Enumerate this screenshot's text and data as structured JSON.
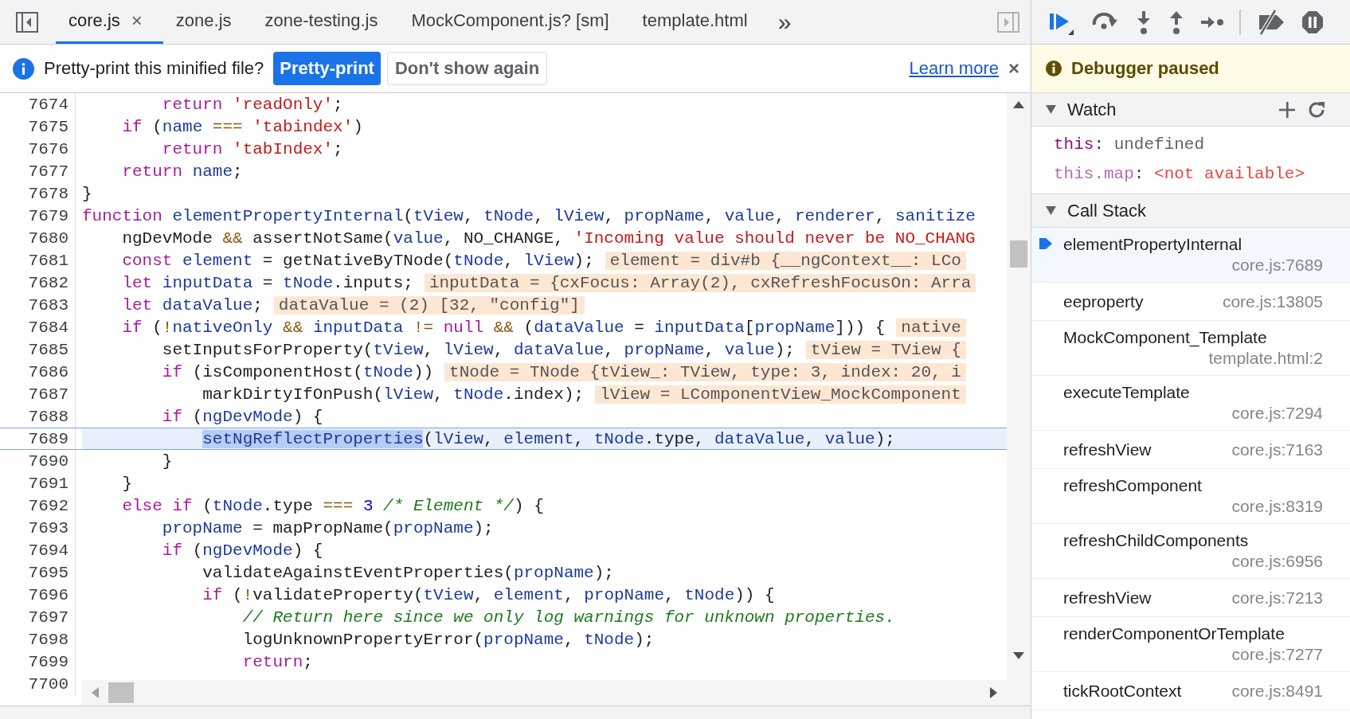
{
  "tabs": [
    {
      "label": "core.js",
      "selected": true,
      "close": "×"
    },
    {
      "label": "zone.js",
      "selected": false
    },
    {
      "label": "zone-testing.js",
      "selected": false
    },
    {
      "label": "MockComponent.js? [sm]",
      "selected": false
    },
    {
      "label": "template.html",
      "selected": false
    }
  ],
  "more_tabs": "»",
  "infobar": {
    "message": "Pretty-print this minified file?",
    "primary_button": "Pretty-print",
    "secondary_button": "Don't show again",
    "link": "Learn more",
    "close": "×"
  },
  "editor": {
    "lines": [
      {
        "number": "7674",
        "selected": false,
        "tokens": [
          {
            "kind": "kw",
            "text": "        return "
          },
          {
            "kind": "str",
            "text": "'readOnly'"
          },
          {
            "kind": "plain",
            "text": ";"
          }
        ]
      },
      {
        "number": "7675",
        "selected": false,
        "tokens": [
          {
            "kind": "kw",
            "text": "    if "
          },
          {
            "kind": "plain",
            "text": "("
          },
          {
            "kind": "var",
            "text": "name"
          },
          {
            "kind": "op",
            "text": " === "
          },
          {
            "kind": "str",
            "text": "'tabindex'"
          },
          {
            "kind": "plain",
            "text": ")"
          }
        ]
      },
      {
        "number": "7676",
        "selected": false,
        "tokens": [
          {
            "kind": "kw",
            "text": "        return "
          },
          {
            "kind": "str",
            "text": "'tabIndex'"
          },
          {
            "kind": "plain",
            "text": ";"
          }
        ]
      },
      {
        "number": "7677",
        "selected": false,
        "tokens": [
          {
            "kind": "kw",
            "text": "    return "
          },
          {
            "kind": "var",
            "text": "name"
          },
          {
            "kind": "plain",
            "text": ";"
          }
        ]
      },
      {
        "number": "7678",
        "selected": false,
        "tokens": [
          {
            "kind": "plain",
            "text": "}"
          }
        ]
      },
      {
        "number": "7679",
        "selected": false,
        "tokens": [
          {
            "kind": "kw",
            "text": "function "
          },
          {
            "kind": "var",
            "text": "elementPropertyInternal"
          },
          {
            "kind": "plain",
            "text": "("
          },
          {
            "kind": "var",
            "text": "tView"
          },
          {
            "kind": "plain",
            "text": ", "
          },
          {
            "kind": "var",
            "text": "tNode"
          },
          {
            "kind": "plain",
            "text": ", "
          },
          {
            "kind": "var",
            "text": "lView"
          },
          {
            "kind": "plain",
            "text": ", "
          },
          {
            "kind": "var",
            "text": "propName"
          },
          {
            "kind": "plain",
            "text": ", "
          },
          {
            "kind": "var",
            "text": "value"
          },
          {
            "kind": "plain",
            "text": ", "
          },
          {
            "kind": "var",
            "text": "renderer"
          },
          {
            "kind": "plain",
            "text": ", "
          },
          {
            "kind": "var",
            "text": "sanitize"
          }
        ]
      },
      {
        "number": "7680",
        "selected": false,
        "tokens": [
          {
            "kind": "plain",
            "text": "    ngDevMode"
          },
          {
            "kind": "op",
            "text": " && "
          },
          {
            "kind": "plain",
            "text": "assertNotSame("
          },
          {
            "kind": "var",
            "text": "value"
          },
          {
            "kind": "plain",
            "text": ", NO_CHANGE, "
          },
          {
            "kind": "str",
            "text": "'Incoming value should never be NO_CHANG"
          }
        ]
      },
      {
        "number": "7681",
        "selected": false,
        "tokens": [
          {
            "kind": "kw",
            "text": "    const "
          },
          {
            "kind": "var",
            "text": "element"
          },
          {
            "kind": "plain",
            "text": " = getNativeByTNode("
          },
          {
            "kind": "var",
            "text": "tNode"
          },
          {
            "kind": "plain",
            "text": ", "
          },
          {
            "kind": "var",
            "text": "lView"
          },
          {
            "kind": "plain",
            "text": ");"
          }
        ],
        "inline_value": "element = div#b {__ngContext__: LCo"
      },
      {
        "number": "7682",
        "selected": false,
        "tokens": [
          {
            "kind": "kw",
            "text": "    let "
          },
          {
            "kind": "var",
            "text": "inputData"
          },
          {
            "kind": "plain",
            "text": " = "
          },
          {
            "kind": "var",
            "text": "tNode"
          },
          {
            "kind": "plain",
            "text": ".inputs;"
          }
        ],
        "inline_value": "inputData = {cxFocus: Array(2), cxRefreshFocusOn: Arra"
      },
      {
        "number": "7683",
        "selected": false,
        "tokens": [
          {
            "kind": "kw",
            "text": "    let "
          },
          {
            "kind": "var",
            "text": "dataValue"
          },
          {
            "kind": "plain",
            "text": ";"
          }
        ],
        "inline_value": "dataValue = (2) [32, \"config\"]"
      },
      {
        "number": "7684",
        "selected": false,
        "tokens": [
          {
            "kind": "kw",
            "text": "    if "
          },
          {
            "kind": "plain",
            "text": "("
          },
          {
            "kind": "op",
            "text": "!"
          },
          {
            "kind": "var",
            "text": "nativeOnly"
          },
          {
            "kind": "op",
            "text": " && "
          },
          {
            "kind": "var",
            "text": "inputData"
          },
          {
            "kind": "op",
            "text": " != "
          },
          {
            "kind": "kw",
            "text": "null"
          },
          {
            "kind": "op",
            "text": " && "
          },
          {
            "kind": "plain",
            "text": "("
          },
          {
            "kind": "var",
            "text": "dataValue"
          },
          {
            "kind": "plain",
            "text": " = "
          },
          {
            "kind": "var",
            "text": "inputData"
          },
          {
            "kind": "plain",
            "text": "["
          },
          {
            "kind": "var",
            "text": "propName"
          },
          {
            "kind": "plain",
            "text": "])) {"
          }
        ],
        "inline_value": "native"
      },
      {
        "number": "7685",
        "selected": false,
        "tokens": [
          {
            "kind": "plain",
            "text": "        setInputsForProperty("
          },
          {
            "kind": "var",
            "text": "tView"
          },
          {
            "kind": "plain",
            "text": ", "
          },
          {
            "kind": "var",
            "text": "lView"
          },
          {
            "kind": "plain",
            "text": ", "
          },
          {
            "kind": "var",
            "text": "dataValue"
          },
          {
            "kind": "plain",
            "text": ", "
          },
          {
            "kind": "var",
            "text": "propName"
          },
          {
            "kind": "plain",
            "text": ", "
          },
          {
            "kind": "var",
            "text": "value"
          },
          {
            "kind": "plain",
            "text": ");"
          }
        ],
        "inline_value": "tView = TView {"
      },
      {
        "number": "7686",
        "selected": false,
        "tokens": [
          {
            "kind": "kw",
            "text": "        if "
          },
          {
            "kind": "plain",
            "text": "(isComponentHost("
          },
          {
            "kind": "var",
            "text": "tNode"
          },
          {
            "kind": "plain",
            "text": "))"
          }
        ],
        "inline_value": "tNode = TNode {tView_: TView, type: 3, index: 20, i"
      },
      {
        "number": "7687",
        "selected": false,
        "tokens": [
          {
            "kind": "plain",
            "text": "            markDirtyIfOnPush("
          },
          {
            "kind": "var",
            "text": "lView"
          },
          {
            "kind": "plain",
            "text": ", "
          },
          {
            "kind": "var",
            "text": "tNode"
          },
          {
            "kind": "plain",
            "text": ".index);"
          }
        ],
        "inline_value": "lView = LComponentView_MockComponent"
      },
      {
        "number": "7688",
        "selected": false,
        "tokens": [
          {
            "kind": "kw",
            "text": "        if "
          },
          {
            "kind": "plain",
            "text": "("
          },
          {
            "kind": "var",
            "text": "ngDevMode"
          },
          {
            "kind": "plain",
            "text": ") {"
          }
        ]
      },
      {
        "number": "7689",
        "selected": true,
        "tokens": [
          {
            "kind": "match",
            "text": "            setNgReflectProperties"
          },
          {
            "kind": "plain",
            "text": "("
          },
          {
            "kind": "var",
            "text": "lView"
          },
          {
            "kind": "plain",
            "text": ", "
          },
          {
            "kind": "var",
            "text": "element"
          },
          {
            "kind": "plain",
            "text": ", "
          },
          {
            "kind": "var",
            "text": "tNode"
          },
          {
            "kind": "plain",
            "text": ".type, "
          },
          {
            "kind": "var",
            "text": "dataValue"
          },
          {
            "kind": "plain",
            "text": ", "
          },
          {
            "kind": "var",
            "text": "value"
          },
          {
            "kind": "plain",
            "text": ");"
          }
        ]
      },
      {
        "number": "7690",
        "selected": false,
        "tokens": [
          {
            "kind": "plain",
            "text": "        }"
          }
        ]
      },
      {
        "number": "7691",
        "selected": false,
        "tokens": [
          {
            "kind": "plain",
            "text": "    }"
          }
        ]
      },
      {
        "number": "7692",
        "selected": false,
        "tokens": [
          {
            "kind": "kw",
            "text": "    else if "
          },
          {
            "kind": "plain",
            "text": "("
          },
          {
            "kind": "var",
            "text": "tNode"
          },
          {
            "kind": "plain",
            "text": ".type"
          },
          {
            "kind": "op",
            "text": " === "
          },
          {
            "kind": "num",
            "text": "3"
          },
          {
            "kind": "com",
            "text": " /* Element */"
          },
          {
            "kind": "plain",
            "text": ") {"
          }
        ]
      },
      {
        "number": "7693",
        "selected": false,
        "tokens": [
          {
            "kind": "var",
            "text": "        propName"
          },
          {
            "kind": "plain",
            "text": " = mapPropName("
          },
          {
            "kind": "var",
            "text": "propName"
          },
          {
            "kind": "plain",
            "text": ");"
          }
        ]
      },
      {
        "number": "7694",
        "selected": false,
        "tokens": [
          {
            "kind": "kw",
            "text": "        if "
          },
          {
            "kind": "plain",
            "text": "("
          },
          {
            "kind": "var",
            "text": "ngDevMode"
          },
          {
            "kind": "plain",
            "text": ") {"
          }
        ]
      },
      {
        "number": "7695",
        "selected": false,
        "tokens": [
          {
            "kind": "plain",
            "text": "            validateAgainstEventProperties("
          },
          {
            "kind": "var",
            "text": "propName"
          },
          {
            "kind": "plain",
            "text": ");"
          }
        ]
      },
      {
        "number": "7696",
        "selected": false,
        "tokens": [
          {
            "kind": "kw",
            "text": "            if "
          },
          {
            "kind": "plain",
            "text": "("
          },
          {
            "kind": "op",
            "text": "!"
          },
          {
            "kind": "plain",
            "text": "validateProperty("
          },
          {
            "kind": "var",
            "text": "tView"
          },
          {
            "kind": "plain",
            "text": ", "
          },
          {
            "kind": "var",
            "text": "element"
          },
          {
            "kind": "plain",
            "text": ", "
          },
          {
            "kind": "var",
            "text": "propName"
          },
          {
            "kind": "plain",
            "text": ", "
          },
          {
            "kind": "var",
            "text": "tNode"
          },
          {
            "kind": "plain",
            "text": ")) {"
          }
        ]
      },
      {
        "number": "7697",
        "selected": false,
        "tokens": [
          {
            "kind": "com",
            "text": "                // Return here since we only log warnings for unknown properties."
          }
        ]
      },
      {
        "number": "7698",
        "selected": false,
        "tokens": [
          {
            "kind": "plain",
            "text": "                logUnknownPropertyError("
          },
          {
            "kind": "var",
            "text": "propName"
          },
          {
            "kind": "plain",
            "text": ", "
          },
          {
            "kind": "var",
            "text": "tNode"
          },
          {
            "kind": "plain",
            "text": ");"
          }
        ]
      },
      {
        "number": "7699",
        "selected": false,
        "tokens": [
          {
            "kind": "kw",
            "text": "                return"
          },
          {
            "kind": "plain",
            "text": ";"
          }
        ]
      },
      {
        "number": "7700",
        "selected": false
      }
    ]
  },
  "debugger": {
    "status": "Debugger paused",
    "watch": {
      "title": "Watch",
      "expanded": true,
      "entries": [
        {
          "kind": "value",
          "expression": "this",
          "separator": ":",
          "value": "undefined"
        },
        {
          "kind": "unavailable",
          "expression": "this.map",
          "separator": ":",
          "value": "<not available>"
        }
      ]
    },
    "call_stack": {
      "title": "Call Stack",
      "expanded": true,
      "frames": [
        {
          "kind": "two-line",
          "name": "elementPropertyInternal",
          "location": "core.js:7689",
          "selected": true
        },
        {
          "kind": "one-line",
          "name": "eeproperty",
          "location": "core.js:13805",
          "selected": false
        },
        {
          "kind": "two-line",
          "name": "MockComponent_Template",
          "location": "template.html:2",
          "selected": false
        },
        {
          "kind": "two-line",
          "name": "executeTemplate",
          "location": "core.js:7294",
          "selected": false
        },
        {
          "kind": "one-line",
          "name": "refreshView",
          "location": "core.js:7163",
          "selected": false
        },
        {
          "kind": "two-line",
          "name": "refreshComponent",
          "location": "core.js:8319",
          "selected": false
        },
        {
          "kind": "two-line",
          "name": "refreshChildComponents",
          "location": "core.js:6956",
          "selected": false
        },
        {
          "kind": "one-line",
          "name": "refreshView",
          "location": "core.js:7213",
          "selected": false
        },
        {
          "kind": "two-line",
          "name": "renderComponentOrTemplate",
          "location": "core.js:7277",
          "selected": false
        },
        {
          "kind": "one-line",
          "name": "tickRootContext",
          "location": "core.js:8491",
          "selected": false
        }
      ]
    }
  }
}
